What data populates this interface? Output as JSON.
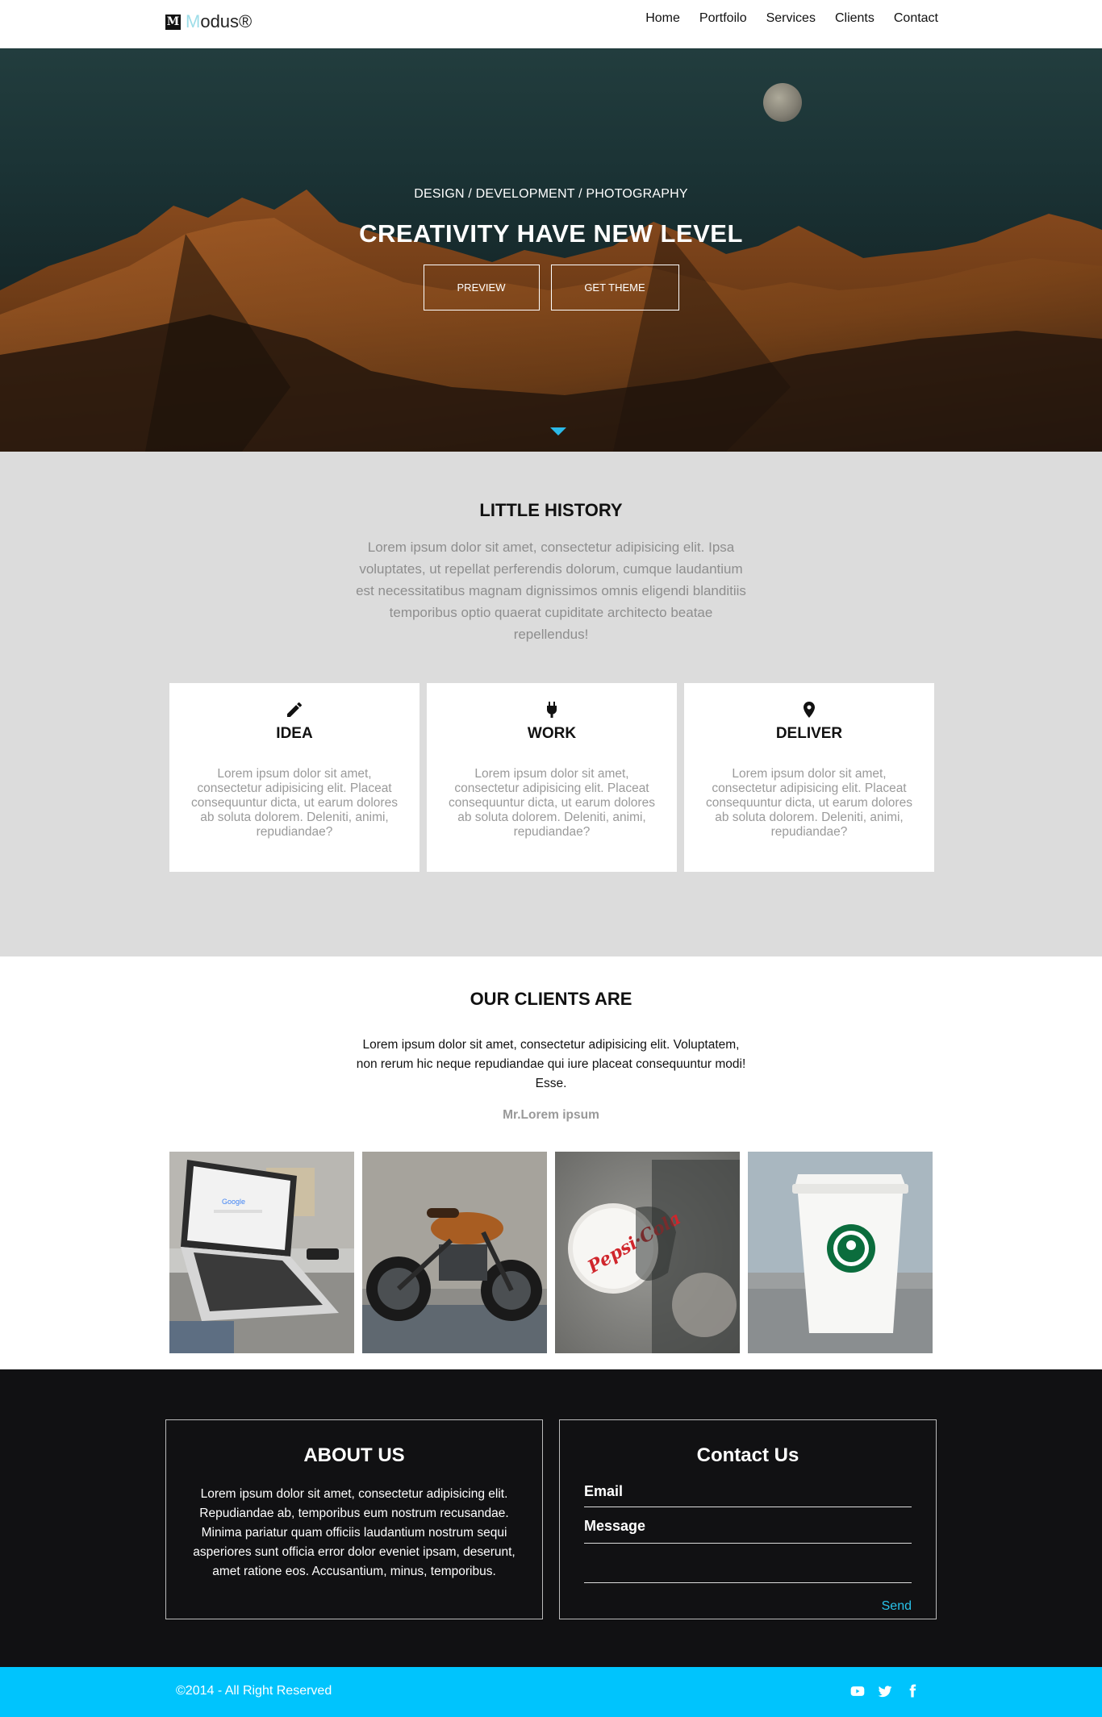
{
  "nav": {
    "logo_mark": "M",
    "logo_first": "M",
    "logo_rest": "odus®",
    "items": [
      {
        "label": "Home"
      },
      {
        "label": "Portfoilo"
      },
      {
        "label": "Services"
      },
      {
        "label": "Clients"
      },
      {
        "label": "Contact"
      }
    ]
  },
  "hero": {
    "subtitle": "DESIGN / DEVELOPMENT / PHOTOGRAPHY",
    "title": "CREATIVITY HAVE NEW LEVEL",
    "buttons": [
      {
        "label": "PREVIEW"
      },
      {
        "label": "GET THEME"
      }
    ],
    "scroll_icon": "chevron-down-icon"
  },
  "history": {
    "title": "LITTLE HISTORY",
    "text": "Lorem ipsum dolor sit amet, consectetur adipisicing elit. Ipsa voluptates, ut repellat perferendis dolorum, cumque laudantium est necessitatibus magnam dignissimos omnis eligendi blanditiis temporibus optio quaerat cupiditate architecto beatae repellendus!",
    "cards": [
      {
        "icon": "pencil-icon",
        "title": "IDEA",
        "text": "Lorem ipsum dolor sit amet, consectetur adipisicing elit. Placeat consequuntur dicta, ut earum dolores ab soluta dolorem. Deleniti, animi, repudiandae?"
      },
      {
        "icon": "plug-icon",
        "title": "WORK",
        "text": "Lorem ipsum dolor sit amet, consectetur adipisicing elit. Placeat consequuntur dicta, ut earum dolores ab soluta dolorem. Deleniti, animi, repudiandae?"
      },
      {
        "icon": "map-pin-icon",
        "title": "DELIVER",
        "text": "Lorem ipsum dolor sit amet, consectetur adipisicing elit. Placeat consequuntur dicta, ut earum dolores ab soluta dolorem. Deleniti, animi, repudiandae?"
      }
    ]
  },
  "clients": {
    "title": "OUR CLIENTS ARE",
    "quote": "Lorem ipsum dolor sit amet, consectetur adipisicing elit. Voluptatem, non rerum hic neque repudiandae qui iure placeat consequuntur modi! Esse.",
    "author": "Mr.Lorem ipsum",
    "photos": [
      "laptop",
      "motorcycle",
      "bottle-cap",
      "coffee-cup"
    ]
  },
  "footer": {
    "about_title": "ABOUT US",
    "about_text": "Lorem ipsum dolor sit amet, consectetur adipisicing elit. Repudiandae ab, temporibus eum nostrum recusandae. Minima pariatur quam officiis laudantium nostrum sequi asperiores sunt officia error dolor eveniet ipsam, deserunt, amet ratione eos. Accusantium, minus, temporibus.",
    "contact_title": "Contact Us",
    "email_label": "Email",
    "message_label": "Message",
    "send_label": "Send",
    "copyright": "©2014 - All Right Reserved",
    "social": [
      "youtube-icon",
      "twitter-icon",
      "facebook-icon"
    ]
  },
  "colors": {
    "accent": "#00c4fd",
    "history_bg": "#dcdcdc",
    "footer_bg": "#111113"
  }
}
